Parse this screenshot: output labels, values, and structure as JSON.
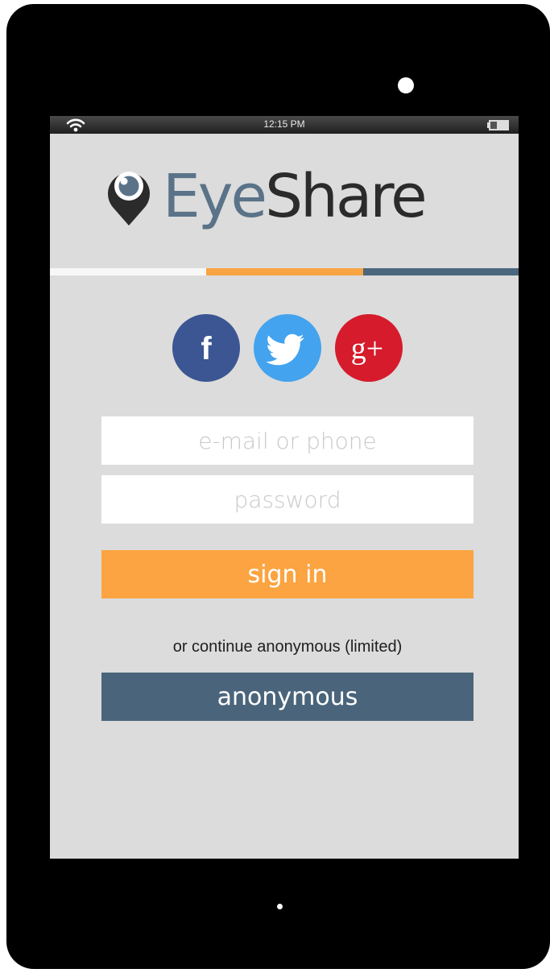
{
  "status_bar": {
    "time": "12:15 PM",
    "icons": [
      "wifi-icon",
      "battery-icon"
    ]
  },
  "app": {
    "logo_icon": "location-pin-eye-icon",
    "brand_first": "Eye",
    "brand_second": "Share"
  },
  "colors": {
    "stripe_white": "#f7f7f7",
    "stripe_orange": "#f9a443",
    "stripe_blue": "#4c677d",
    "facebook": "#3b5692",
    "twitter": "#43a3ee",
    "google_plus": "#d51b2c",
    "sign_in": "#fba441",
    "anonymous": "#4a657b",
    "screen_bg": "#dcdcdc"
  },
  "social": [
    {
      "name": "facebook",
      "icon": "facebook-icon",
      "glyph": "f"
    },
    {
      "name": "twitter",
      "icon": "twitter-icon"
    },
    {
      "name": "google-plus",
      "icon": "google-plus-icon",
      "glyph": "g+"
    }
  ],
  "login": {
    "email_placeholder": "e-mail or phone",
    "email_value": "",
    "password_placeholder": "password",
    "password_value": "",
    "sign_in_label": "sign in",
    "or_text": "or continue anonymous (limited)",
    "anonymous_label": "anonymous"
  }
}
